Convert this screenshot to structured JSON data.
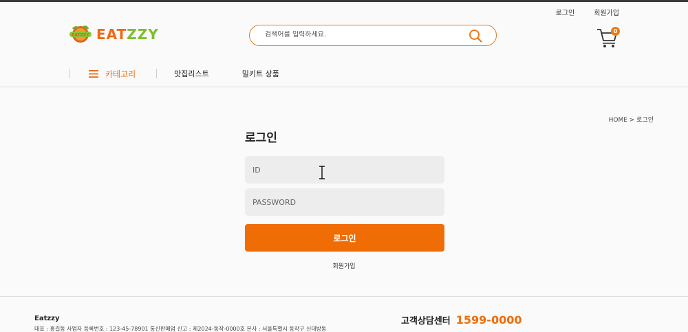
{
  "util": {
    "login": "로그인",
    "join": "회원가입"
  },
  "brand": {
    "name_a": "EAT",
    "name_b": "ZZY",
    "mark_text": "EATZZY"
  },
  "search": {
    "placeholder": "검색어를 입력하세요."
  },
  "cart": {
    "count": "0"
  },
  "nav": {
    "category": "카테고리",
    "items": [
      "맛집리스트",
      "밀키트 상품"
    ]
  },
  "breadcrumb": "HOME > 로그인",
  "login": {
    "title": "로그인",
    "id_placeholder": "ID",
    "pw_placeholder": "PASSWORD",
    "button": "로그인",
    "join_link": "회원가입"
  },
  "footer": {
    "company": "Eatzzy",
    "info": "대표 : 홍길동    사업자 등록번호 : 123-45-78901    통신판매업 신고 : 제2024-동작-0000호 본사 : 서울특별시 동작구 신대방동",
    "cs_label": "고객상담센터",
    "cs_number": "1599-0000"
  },
  "colors": {
    "accent": "#f06c05",
    "logo_green": "#7cbf2f",
    "field_bg": "#ededee"
  },
  "icons": {
    "search": "search-icon",
    "cart": "cart-icon",
    "menu": "hamburger-icon",
    "cursor": "text-cursor-icon"
  }
}
